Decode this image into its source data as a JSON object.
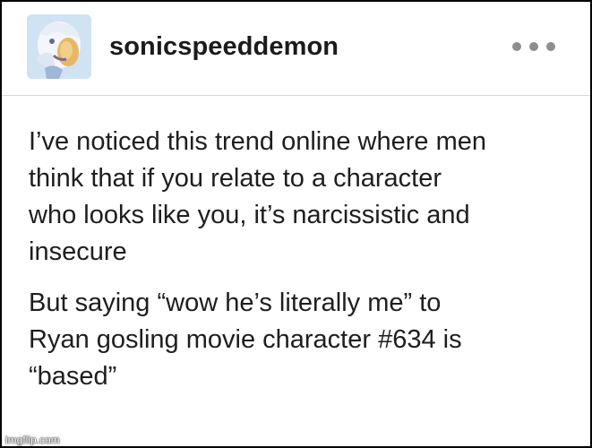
{
  "post": {
    "username": "sonicspeeddemon",
    "avatar_icon": "character-avatar",
    "more_icon": "more-horizontal-icon",
    "paragraphs": {
      "first": {
        "line1": "I’ve noticed this trend online where men",
        "line2": "think that if you relate to a character",
        "line3": "who looks like you, it’s narcissistic and",
        "line4": "insecure"
      },
      "second": {
        "line1": "But saying “wow he’s literally me” to",
        "line2": "Ryan gosling movie character #634 is",
        "line3": "“based”"
      }
    }
  },
  "watermark": {
    "text": "imgflip.com"
  }
}
